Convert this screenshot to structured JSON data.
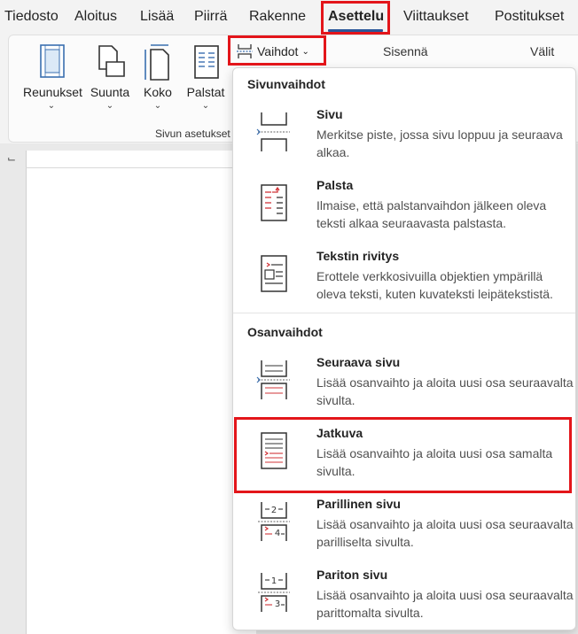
{
  "tabs": [
    {
      "label": "Tiedosto"
    },
    {
      "label": "Aloitus"
    },
    {
      "label": "Lisää"
    },
    {
      "label": "Piirrä"
    },
    {
      "label": "Rakenne"
    },
    {
      "label": "Asettelu",
      "active": true
    },
    {
      "label": "Viittaukset"
    },
    {
      "label": "Postitukset"
    }
  ],
  "ribbon": {
    "buttons": [
      {
        "label": "Reunukset",
        "icon": "margins-icon"
      },
      {
        "label": "Suunta",
        "icon": "orientation-icon"
      },
      {
        "label": "Koko",
        "icon": "size-icon"
      },
      {
        "label": "Palstat",
        "icon": "columns-icon"
      }
    ],
    "group_label": "Sivun asetukset",
    "breaks_button": "Vaihdot",
    "indent_label": "Sisennä",
    "spacing_label": "Välit"
  },
  "dropdown": {
    "page_breaks_header": "Sivunvaihdot",
    "section_breaks_header": "Osanvaihdot",
    "page_breaks": [
      {
        "title": "Sivu",
        "desc": "Merkitse piste, jossa sivu loppuu ja seuraava alkaa.",
        "icon": "page-break-icon"
      },
      {
        "title": "Palsta",
        "desc": "Ilmaise, että palstanvaihdon jälkeen oleva teksti alkaa seuraavasta palstasta.",
        "icon": "column-break-icon"
      },
      {
        "title": "Tekstin rivitys",
        "desc": "Erottele verkkosivuilla objektien ympärillä oleva teksti, kuten kuvateksti leipätekstistä.",
        "icon": "text-wrapping-icon"
      }
    ],
    "section_breaks": [
      {
        "title": "Seuraava sivu",
        "desc": "Lisää osanvaihto ja aloita uusi osa seuraavalta sivulta.",
        "icon": "next-page-icon"
      },
      {
        "title": "Jatkuva",
        "desc": "Lisää osanvaihto ja aloita uusi osa samalta sivulta.",
        "icon": "continuous-icon"
      },
      {
        "title": "Parillinen sivu",
        "desc": "Lisää osanvaihto ja aloita uusi osa seuraavalta parilliselta sivulta.",
        "icon": "even-page-icon"
      },
      {
        "title": "Pariton sivu",
        "desc": "Lisää osanvaihto ja aloita uusi osa seuraavalta parittomalta sivulta.",
        "icon": "odd-page-icon"
      }
    ]
  },
  "icon_numbers": {
    "even_top": "2",
    "even_bottom": "4",
    "odd_top": "1",
    "odd_bottom": "3"
  },
  "colors": {
    "accent": "#2b579a",
    "highlight": "#e3151a",
    "break_red": "#d13438"
  }
}
